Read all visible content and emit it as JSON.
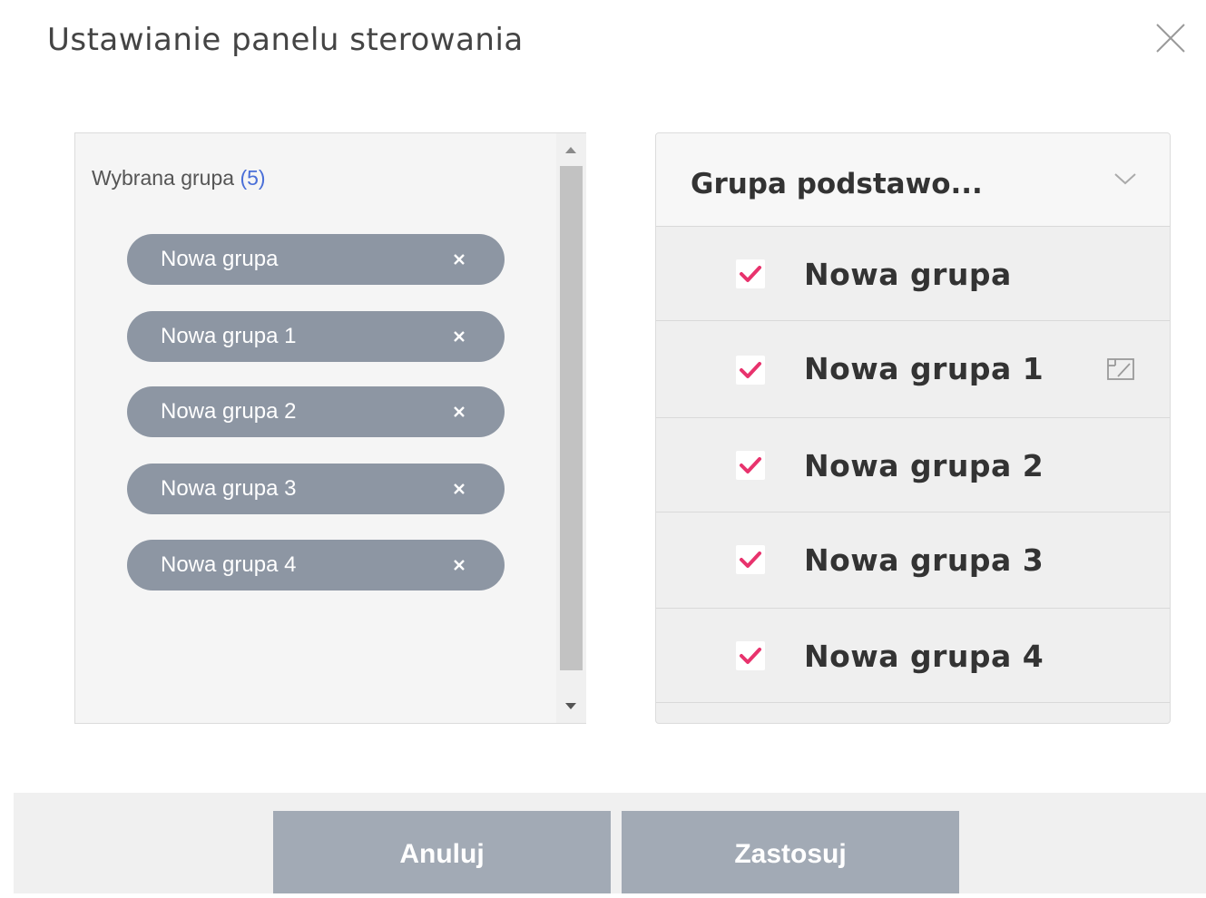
{
  "dialog": {
    "title": "Ustawianie panelu sterowania"
  },
  "selected": {
    "label": "Wybrana grupa",
    "count": "(5)",
    "chips": [
      {
        "label": "Nowa grupa"
      },
      {
        "label": "Nowa grupa 1"
      },
      {
        "label": "Nowa grupa 2"
      },
      {
        "label": "Nowa grupa 3"
      },
      {
        "label": "Nowa grupa 4"
      }
    ]
  },
  "groups": {
    "selected_value": "Grupa podstawo...",
    "rows": [
      {
        "label": "Nowa grupa",
        "checked": true
      },
      {
        "label": "Nowa grupa 1",
        "checked": true
      },
      {
        "label": "Nowa grupa 2",
        "checked": true
      },
      {
        "label": "Nowa grupa 3",
        "checked": true
      },
      {
        "label": "Nowa grupa 4",
        "checked": true
      }
    ]
  },
  "footer": {
    "cancel_label": "Anuluj",
    "apply_label": "Zastosuj"
  },
  "colors": {
    "accent_check": "#e8336d",
    "chip_bg": "#8d96a3",
    "button_bg": "#a2aab5",
    "count_text": "#4a6fd8"
  },
  "icons": {
    "close": "close-icon",
    "chip_remove": "close-icon",
    "dropdown": "chevron-down-icon",
    "checkbox": "checkmark-icon",
    "edit": "edit-icon"
  }
}
